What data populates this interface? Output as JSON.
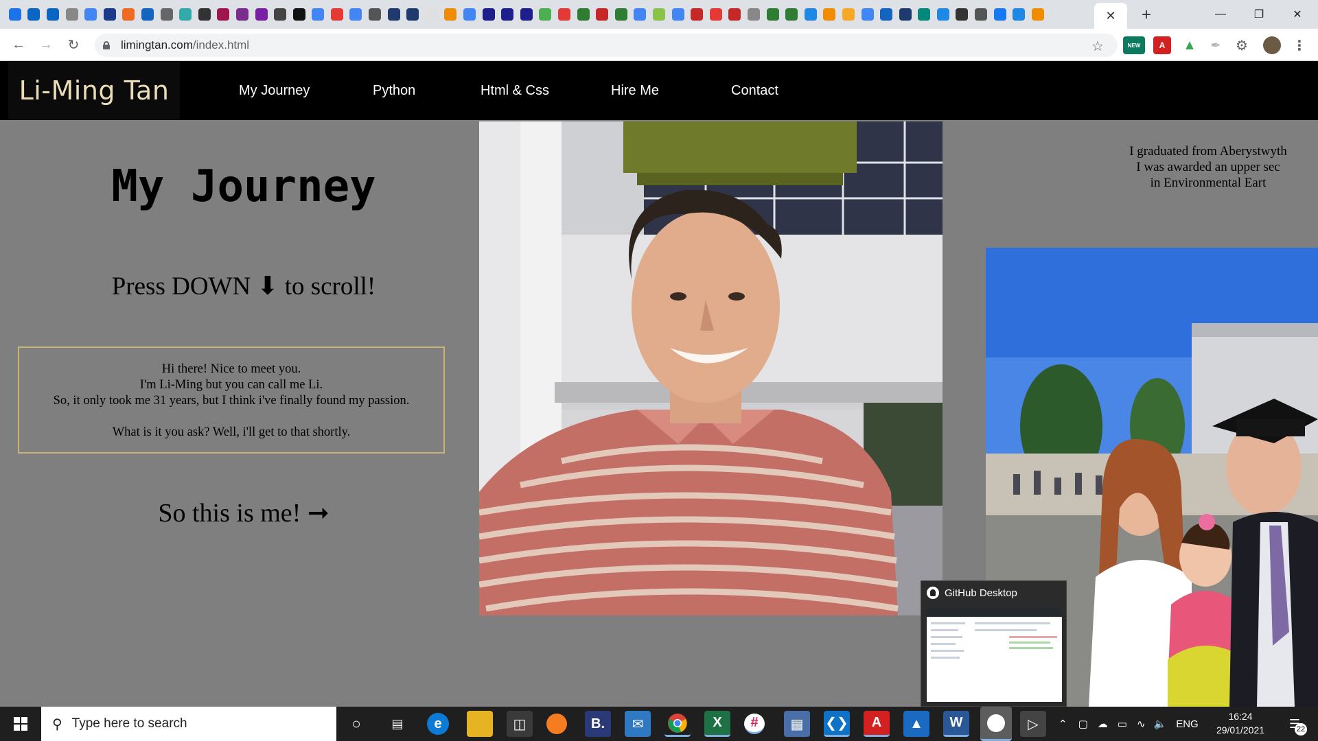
{
  "browser": {
    "tab_close_label": "✕",
    "new_tab_label": "+",
    "window_controls": {
      "minimize": "—",
      "maximize": "❐",
      "close": "✕"
    },
    "url_host": "limingtan.com",
    "url_path": "/index.html",
    "extension_badge": "NEW"
  },
  "site": {
    "logo": "Li-Ming Tan",
    "nav": [
      "My Journey",
      "Python",
      "Html & Css",
      "Hire Me",
      "Contact"
    ],
    "title": "My Journey",
    "scroll_hint": "Press DOWN ⬇ to scroll!",
    "intro_lines": [
      "Hi there! Nice to meet you.",
      "I'm Li-Ming but you can call me Li.",
      "So, it only took me 31 years, but I think i've finally found my passion.",
      "What is it you ask? Well, i'll get to that shortly."
    ],
    "this_is_me": "So this is me! ➞",
    "grad_text": [
      "I graduated from Aberystwyth",
      "I was awarded an upper sec",
      "in Environmental Eart"
    ]
  },
  "preview": {
    "title": "GitHub Desktop"
  },
  "taskbar": {
    "search_placeholder": "Type here to search",
    "tray_language": "ENG",
    "time": "16:24",
    "date": "29/01/2021",
    "notification_count": "22"
  }
}
